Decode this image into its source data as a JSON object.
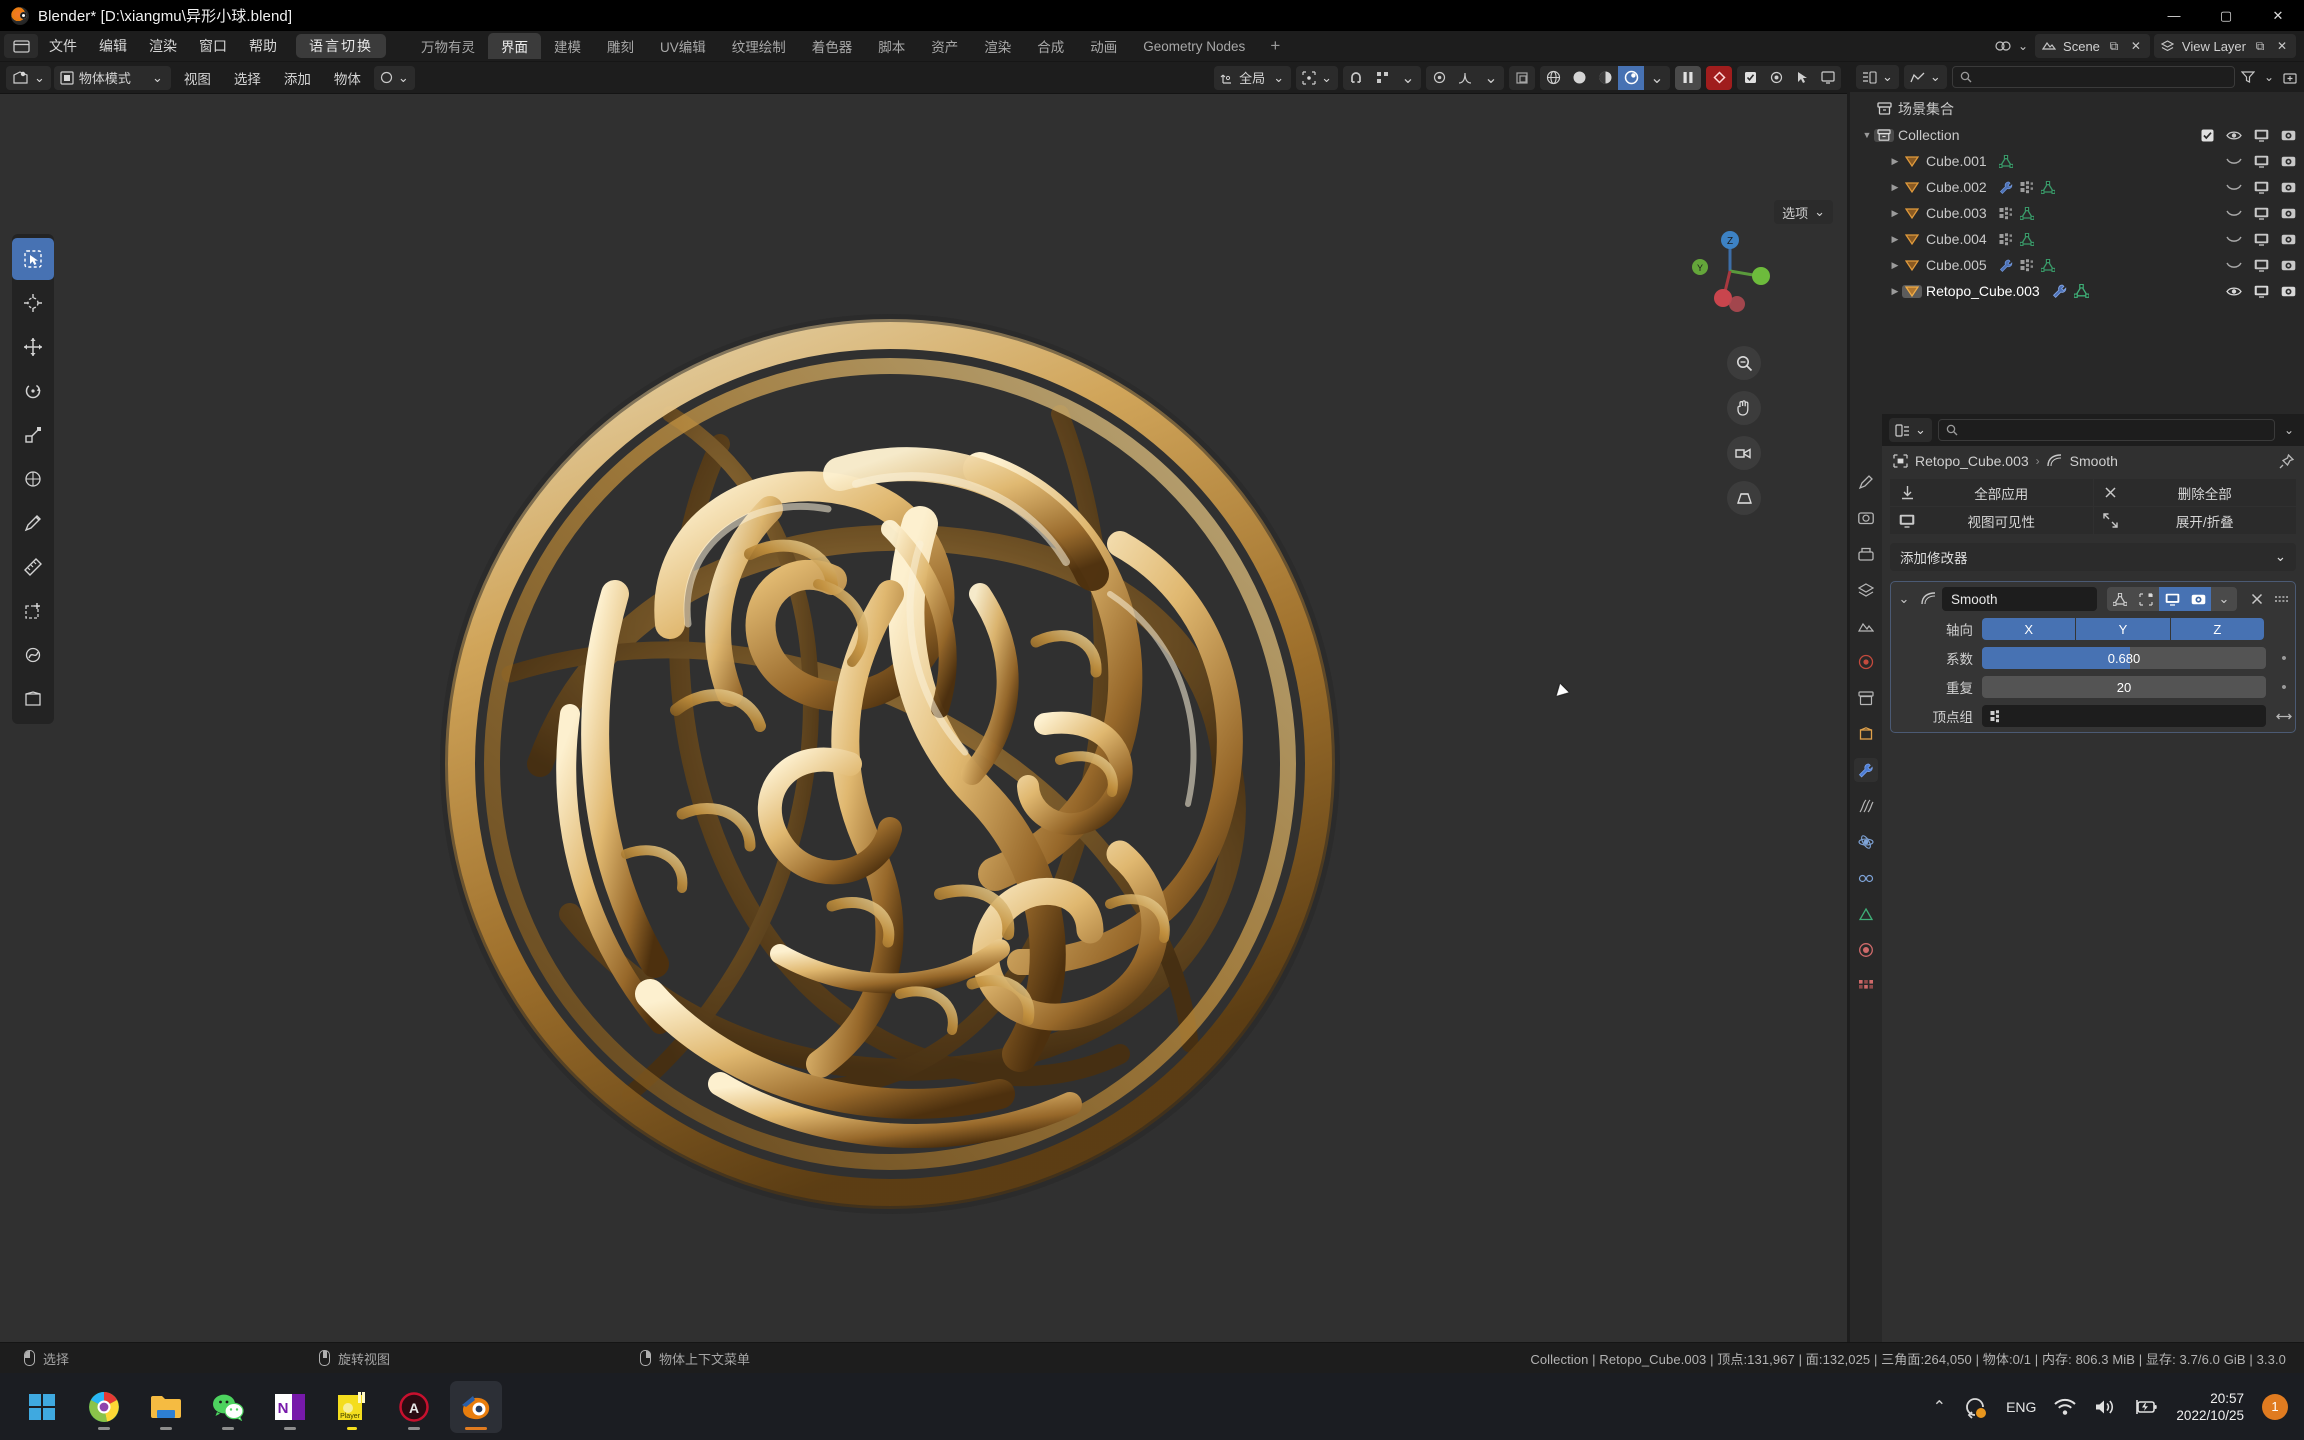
{
  "window": {
    "title": "Blender* [D:\\xiangmu\\异形小球.blend]",
    "minimize": "—",
    "maximize": "▢",
    "close": "✕"
  },
  "topbar": {
    "menus": [
      "文件",
      "编辑",
      "渲染",
      "窗口",
      "帮助"
    ],
    "language_button": "语言切换",
    "workspace_tabs": [
      {
        "label": "万物有灵",
        "active": false
      },
      {
        "label": "界面",
        "active": true
      },
      {
        "label": "建模",
        "active": false
      },
      {
        "label": "雕刻",
        "active": false
      },
      {
        "label": "UV编辑",
        "active": false
      },
      {
        "label": "纹理绘制",
        "active": false
      },
      {
        "label": "着色器",
        "active": false
      },
      {
        "label": "脚本",
        "active": false
      },
      {
        "label": "资产",
        "active": false
      },
      {
        "label": "渲染",
        "active": false
      },
      {
        "label": "合成",
        "active": false
      },
      {
        "label": "动画",
        "active": false
      },
      {
        "label": "Geometry Nodes",
        "active": false
      }
    ],
    "add_workspace": "+",
    "scene_name": "Scene",
    "view_layer_name": "View Layer"
  },
  "viewport": {
    "mode": "物体模式",
    "menus": [
      "视图",
      "选择",
      "添加",
      "物体"
    ],
    "transform_orientation": "全局",
    "options_label": "选项",
    "tools": [
      {
        "name": "tweak-tool",
        "active": true
      },
      {
        "name": "cursor-tool",
        "active": false
      },
      {
        "name": "move-tool",
        "active": false
      },
      {
        "name": "rotate-tool",
        "active": false
      },
      {
        "name": "scale-tool",
        "active": false
      },
      {
        "name": "transform-tool",
        "active": false
      },
      {
        "name": "annotate-tool",
        "active": false
      },
      {
        "name": "measure-tool",
        "active": false
      },
      {
        "name": "add-cube-tool",
        "active": false
      },
      {
        "name": "shear-tool",
        "active": false
      },
      {
        "name": "empty-tool",
        "active": false
      }
    ],
    "gizmo_axes": {
      "z": "Z",
      "y": "Y",
      "x": "X"
    }
  },
  "outliner": {
    "search_placeholder": "",
    "scene_collection": "场景集合",
    "collection": "Collection",
    "items": [
      {
        "name": "Cube.001",
        "mods": [
          "mesh-data-icon"
        ],
        "visible": false,
        "active": false
      },
      {
        "name": "Cube.002",
        "mods": [
          "wrench-icon",
          "modifier-icon",
          "mesh-data-icon"
        ],
        "visible": false,
        "active": false
      },
      {
        "name": "Cube.003",
        "mods": [
          "modifier-icon",
          "mesh-data-icon"
        ],
        "visible": false,
        "active": false
      },
      {
        "name": "Cube.004",
        "mods": [
          "modifier-icon",
          "mesh-data-icon"
        ],
        "visible": false,
        "active": false
      },
      {
        "name": "Cube.005",
        "mods": [
          "wrench-icon",
          "modifier-icon",
          "mesh-data-icon"
        ],
        "visible": false,
        "active": false
      },
      {
        "name": "Retopo_Cube.003",
        "mods": [
          "wrench-icon",
          "mesh-data-icon"
        ],
        "visible": true,
        "active": true
      }
    ]
  },
  "properties": {
    "search_placeholder": "",
    "breadcrumb_object": "Retopo_Cube.003",
    "breadcrumb_sep": "›",
    "breadcrumb_modifier": "Smooth",
    "buttons": {
      "apply_all": "全部应用",
      "delete_all": "删除全部",
      "viewport_visibility": "视图可见性",
      "expand_collapse": "展开/折叠"
    },
    "add_modifier": "添加修改器",
    "modifier": {
      "name": "Smooth",
      "axis_label": "轴向",
      "axis_x": "X",
      "axis_y": "Y",
      "axis_z": "Z",
      "factor_label": "系数",
      "factor_value": "0.680",
      "factor_fill_percent": 52,
      "repeat_label": "重复",
      "repeat_value": "20",
      "vertex_group_label": "顶点组",
      "vertex_group_value": ""
    }
  },
  "statusbar": {
    "keymap": [
      {
        "mouse": "l",
        "label": "选择"
      },
      {
        "mouse": "m",
        "label": "旋转视图"
      },
      {
        "mouse": "r",
        "label": "物体上下文菜单"
      }
    ],
    "stats": "Collection | Retopo_Cube.003 | 顶点:131,967 | 面:132,025 | 三角面:264,050 | 物体:0/1 | 内存: 806.3 MiB | 显存: 3.7/6.0 GiB | 3.3.0"
  },
  "taskbar": {
    "apps": [
      {
        "name": "start-button",
        "active": false
      },
      {
        "name": "chrome-app",
        "active": false
      },
      {
        "name": "file-explorer-app",
        "active": false
      },
      {
        "name": "wechat-app",
        "active": false
      },
      {
        "name": "onenote-app",
        "active": false
      },
      {
        "name": "player-app",
        "active": false
      },
      {
        "name": "autodesk-app",
        "active": false
      },
      {
        "name": "blender-app",
        "active": true
      }
    ],
    "tray": {
      "chevron": "⌃",
      "language": "ENG",
      "time": "20:57",
      "date": "2022/10/25",
      "notification_count": "1"
    }
  },
  "colors": {
    "accent_blue": "#4772b3",
    "record_red": "#a01d1d",
    "bg_dark": "#1d1d1d",
    "bg_viewport": "#303030",
    "gold_light": "#e8cf9a",
    "gold_mid": "#c9953f",
    "gold_dark": "#6e4a18"
  }
}
